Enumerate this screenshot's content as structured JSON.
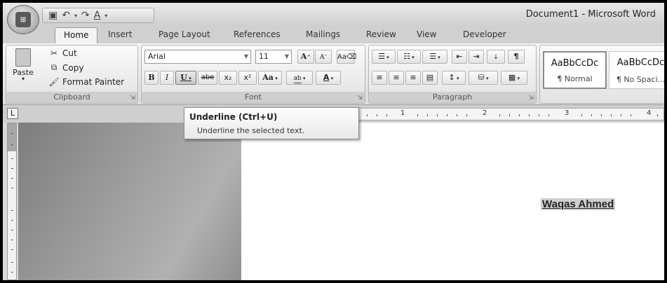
{
  "window": {
    "title": "Document1 - Microsoft Word"
  },
  "quick_access": [
    {
      "name": "save-icon",
      "glyph": "💾"
    },
    {
      "name": "undo-icon",
      "glyph": "↶"
    },
    {
      "name": "redo-icon",
      "glyph": "↷"
    },
    {
      "name": "format-icon",
      "glyph": "A"
    }
  ],
  "tabs": [
    "Home",
    "Insert",
    "Page Layout",
    "References",
    "Mailings",
    "Review",
    "View",
    "Developer"
  ],
  "clipboard": {
    "paste": "Paste",
    "cut": "Cut",
    "copy": "Copy",
    "format_painter": "Format Painter",
    "label": "Clipboard"
  },
  "font": {
    "name": "Arial",
    "size": "11",
    "label": "Font",
    "grow": "A",
    "shrink": "A",
    "bold": "B",
    "italic": "I",
    "underline": "U",
    "strike": "abe",
    "subscript": "x₂",
    "superscript": "x²",
    "case": "Aa",
    "highlight": "ab",
    "color": "A"
  },
  "paragraph": {
    "label": "Paragraph"
  },
  "styles": [
    {
      "sample": "AaBbCcDc",
      "name": "¶ Normal"
    },
    {
      "sample": "AaBbCcDc",
      "name": "¶ No Spaci..."
    }
  ],
  "ruler": {
    "marks": [
      "1",
      "2",
      "3",
      "4"
    ]
  },
  "document": {
    "text": "Waqas Ahmed"
  },
  "tooltip": {
    "title": "Underline (Ctrl+U)",
    "description": "Underline the selected text."
  }
}
